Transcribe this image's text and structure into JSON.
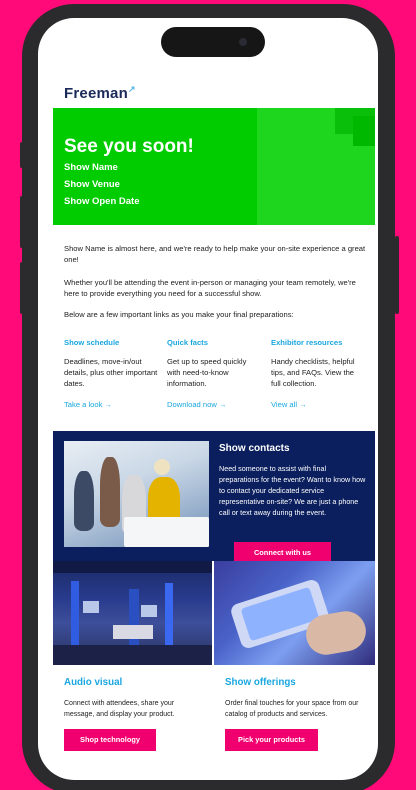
{
  "brand": {
    "name": "Freeman"
  },
  "hero": {
    "title": "See you soon!",
    "lines": [
      "Show Name",
      "Show Venue",
      "Show Open Date"
    ]
  },
  "intro": [
    "Show Name is almost here, and we're ready to help make your on-site experience a great one!",
    "Whether you'll be attending the event in-person or managing your team remotely, we're here to provide everything you need for a successful show.",
    "Below are a few important links as you make your final preparations:"
  ],
  "columns": [
    {
      "title": "Show schedule",
      "text": "Deadlines, move-in/out details, plus other important dates.",
      "link": "Take a look →"
    },
    {
      "title": "Quick facts",
      "text": "Get up to speed quickly with need-to-know information.",
      "link": "Download now →"
    },
    {
      "title": "Exhibitor resources",
      "text": "Handy checklists, helpful tips, and FAQs. View the full collection.",
      "link": "View all →"
    }
  ],
  "contacts": {
    "title": "Show contacts",
    "text": "Need someone to assist with final preparations for the event? Want to know how to contact your dedicated service representative on-site? We are just a phone call or text away during the event.",
    "button": "Connect with us"
  },
  "sections": [
    {
      "title": "Audio visual",
      "text": "Connect with attendees, share your message, and display your product.",
      "button": "Shop technology"
    },
    {
      "title": "Show offerings",
      "text": "Order final touches for your space from our catalog of products and services.",
      "button": "Pick your products"
    }
  ],
  "colors": {
    "background": "#ff0a78",
    "hero": "#00cc00",
    "accent": "#1aa7e0",
    "navy": "#0b1f5e",
    "button": "#f0006e"
  }
}
